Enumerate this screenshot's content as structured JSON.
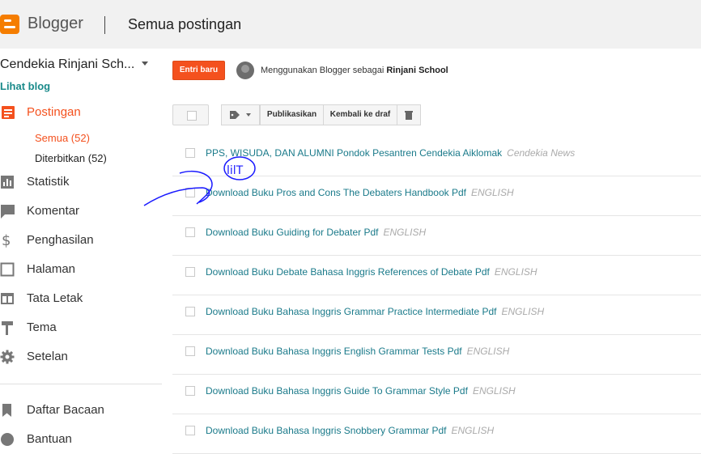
{
  "header": {
    "brand": "Blogger",
    "page_title": "Semua postingan"
  },
  "sidebar": {
    "blog_name": "Cendekia Rinjani Sch...",
    "view_blog": "Lihat blog",
    "nav": [
      {
        "label": "Postingan",
        "icon": "posts-icon",
        "active": true
      },
      {
        "label": "Statistik",
        "icon": "stats-icon"
      },
      {
        "label": "Komentar",
        "icon": "comment-icon"
      },
      {
        "label": "Penghasilan",
        "icon": "dollar-icon"
      },
      {
        "label": "Halaman",
        "icon": "page-icon"
      },
      {
        "label": "Tata Letak",
        "icon": "layout-icon"
      },
      {
        "label": "Tema",
        "icon": "paint-roller-icon"
      },
      {
        "label": "Setelan",
        "icon": "gear-icon"
      },
      {
        "label": "Daftar Bacaan",
        "icon": "bookmark-icon"
      },
      {
        "label": "Bantuan",
        "icon": "help-icon"
      }
    ],
    "sub": [
      {
        "label": "Semua (52)",
        "active": true
      },
      {
        "label": "Diterbitkan (52)"
      }
    ]
  },
  "main": {
    "new_post": "Entri baru",
    "using_prefix": "Menggunakan Blogger sebagai ",
    "using_name": "Rinjani School",
    "toolbar": {
      "publish": "Publikasikan",
      "revert": "Kembali ke draf"
    },
    "posts": [
      {
        "title": "PPS, WISUDA, DAN ALUMNI Pondok Pesantren Cendekia Aiklomak",
        "category": "Cendekia News"
      },
      {
        "title": "Download Buku Pros and Cons The Debaters Handbook Pdf",
        "category": "ENGLISH"
      },
      {
        "title": "Download Buku Guiding for Debater Pdf",
        "category": "ENGLISH"
      },
      {
        "title": "Download Buku Debate Bahasa Inggris References of Debate Pdf",
        "category": "ENGLISH"
      },
      {
        "title": "Download Buku Bahasa Inggris Grammar Practice Intermediate Pdf",
        "category": "ENGLISH"
      },
      {
        "title": "Download Buku Bahasa Inggris English Grammar Tests Pdf",
        "category": "ENGLISH"
      },
      {
        "title": "Download Buku Bahasa Inggris Guide To Grammar Style Pdf",
        "category": "ENGLISH"
      },
      {
        "title": "Download Buku Bahasa Inggris Snobbery Grammar Pdf",
        "category": "ENGLISH"
      }
    ]
  },
  "annotation": {
    "handwritten_text": "lilT"
  },
  "colors": {
    "accent": "#f4511e",
    "link": "#1a7a8a",
    "logo": "#f57d00",
    "ink": "#1a1aff"
  }
}
